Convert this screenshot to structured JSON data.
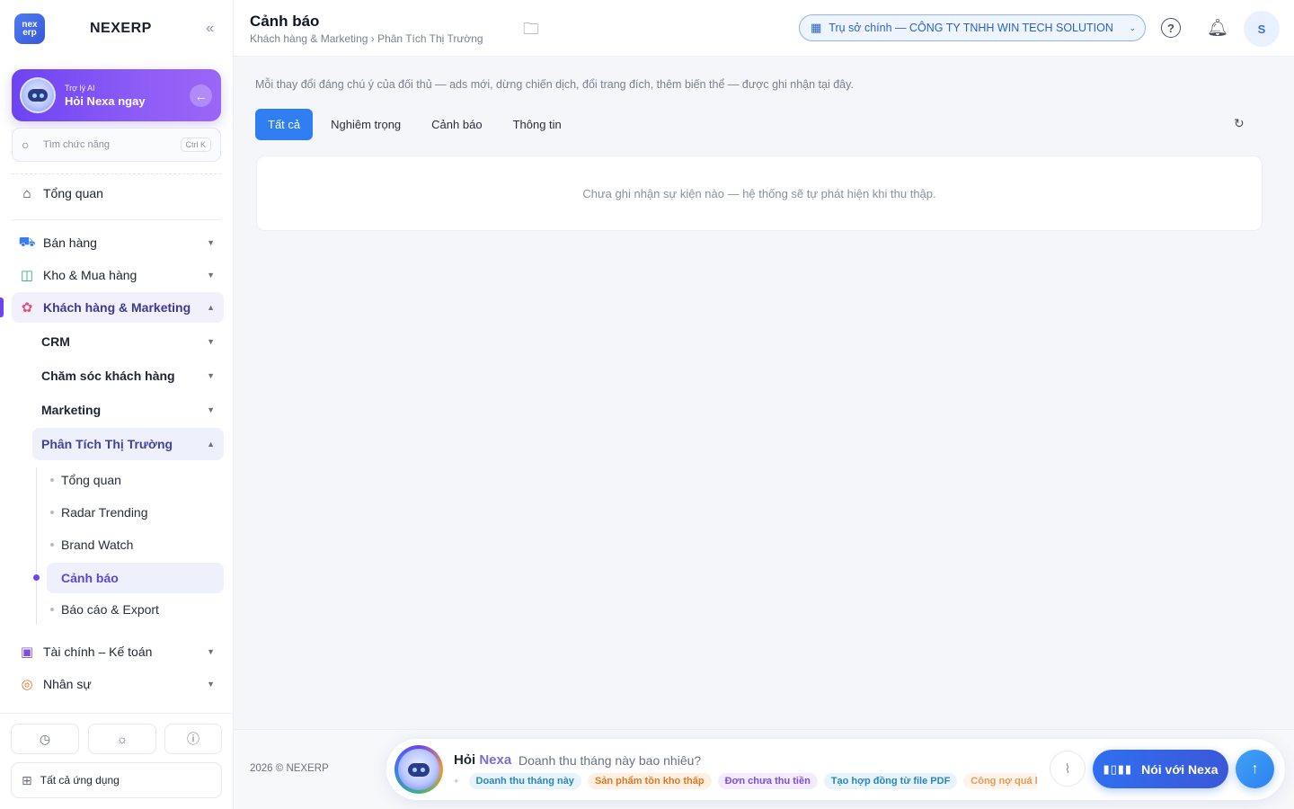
{
  "sidebar": {
    "brand": "NEXERP",
    "logo_top": "nex",
    "logo_bottom": "erp",
    "ai_card": {
      "sub": "Trợ lý AI",
      "title": "Hỏi Nexa ngay"
    },
    "search": {
      "placeholder": "Tìm chức năng",
      "shortcut": "Ctrl K"
    },
    "overview": "Tổng quan",
    "groups": [
      {
        "label": "Bán hàng",
        "icon": "cart-icon"
      },
      {
        "label": "Kho & Mua hàng",
        "icon": "bag-icon"
      },
      {
        "label": "Khách hàng & Marketing",
        "icon": "users-icon"
      }
    ],
    "subs": [
      {
        "label": "CRM"
      },
      {
        "label": "Chăm sóc khách hàng"
      },
      {
        "label": "Marketing"
      },
      {
        "label": "Phân Tích Thị Trường"
      }
    ],
    "leaves": [
      {
        "label": "Tổng quan"
      },
      {
        "label": "Radar Trending"
      },
      {
        "label": "Brand Watch"
      },
      {
        "label": "Cảnh báo"
      },
      {
        "label": "Báo cáo & Export"
      }
    ],
    "groups_after": [
      {
        "label": "Tài chính – Kế toán",
        "icon": "calculator-icon"
      },
      {
        "label": "Nhân sự",
        "icon": "person-icon"
      }
    ],
    "all_apps": "Tất cả ứng dụng"
  },
  "header": {
    "title": "Cảnh báo",
    "breadcrumb": "Khách hàng & Marketing › Phân Tích Thị Trường",
    "company": "Trụ sở chính — CÔNG TY TNHH WIN TECH SOLUTION",
    "avatar_initial": "S"
  },
  "main": {
    "description": "Mỗi thay đổi đáng chú ý của đối thủ — ads mới, dừng chiến dịch, đổi trang đích, thêm biến thể — được ghi nhận tại đây.",
    "tabs": [
      {
        "label": "Tất cả"
      },
      {
        "label": "Nghiêm trọng"
      },
      {
        "label": "Cảnh báo"
      },
      {
        "label": "Thông tin"
      }
    ],
    "empty_message": "Chưa ghi nhận sự kiện nào — hệ thống sẽ tự phát hiện khi thu thập."
  },
  "footer": {
    "copyright": "2026 © NEXERP",
    "ask_prefix": "Hỏi",
    "ask_brand": "Nexa",
    "placeholder": "Doanh thu tháng này bao nhiêu?",
    "chips": [
      "Doanh thu tháng này",
      "Sản phẩm tồn kho thấp",
      "Đơn chưa thu tiền",
      "Tạo hợp đồng từ file PDF",
      "Công nợ quá hạn"
    ],
    "voice_label": "Nói với Nexa"
  },
  "colors": {
    "accent": "#6d44f2",
    "primary": "#2f7ff2"
  }
}
